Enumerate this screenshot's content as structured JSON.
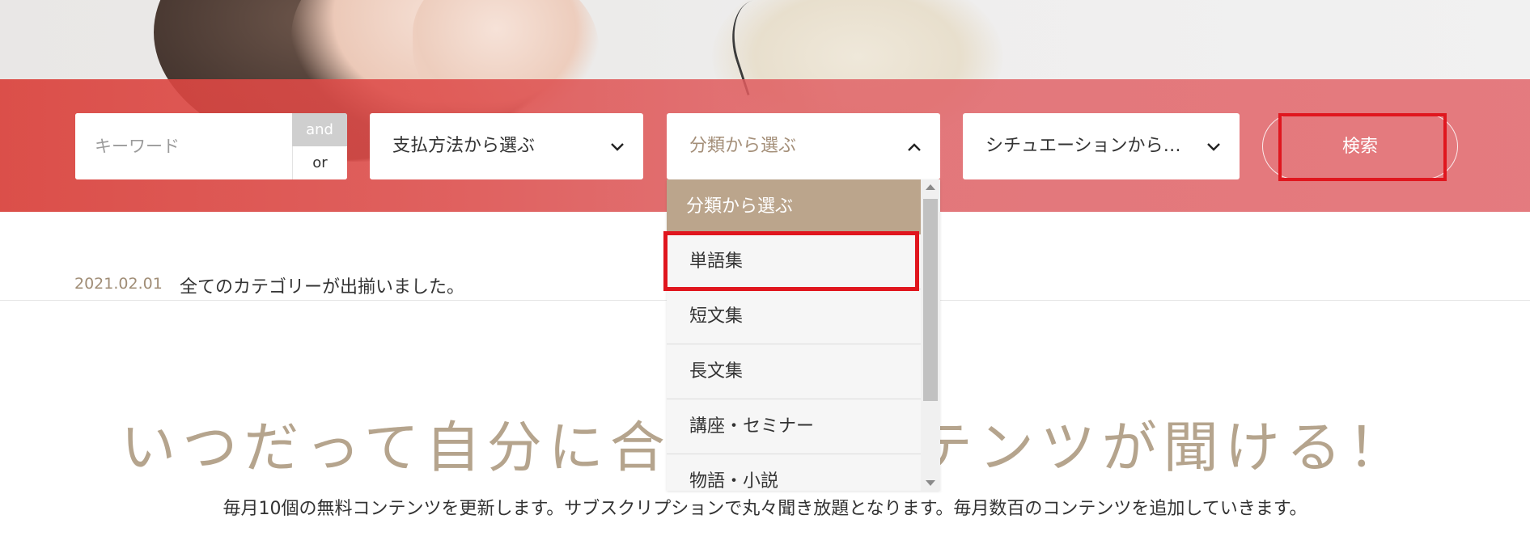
{
  "search": {
    "keyword_placeholder": "キーワード",
    "and_label": "and",
    "or_label": "or",
    "payment_select": "支払方法から選ぶ",
    "category_select": "分類から選ぶ",
    "situation_select": "シチュエーションから選ぶ",
    "search_button": "検索"
  },
  "dropdown": {
    "options": [
      "分類から選ぶ",
      "単語集",
      "短文集",
      "長文集",
      "講座・セミナー",
      "物語・小説"
    ],
    "selected_index": 0,
    "highlighted_index": 1
  },
  "news": {
    "date": "2021.02.01",
    "text": "全てのカテゴリーが出揃いました。"
  },
  "headline": "いつだって自分に合ったコンテンツが聞ける！",
  "subtext": "毎月10個の無料コンテンツを更新します。サブスクリプションで丸々聞き放題となります。毎月数百のコンテンツを追加していきます。",
  "colors": {
    "band": "#de4f4f",
    "accent_gold": "#b5a48d",
    "dropdown_selected": "#bba58c",
    "highlight_red": "#e0161e"
  },
  "icons": {
    "select_closed": "chevron-down-icon",
    "select_open": "chevron-up-icon"
  }
}
